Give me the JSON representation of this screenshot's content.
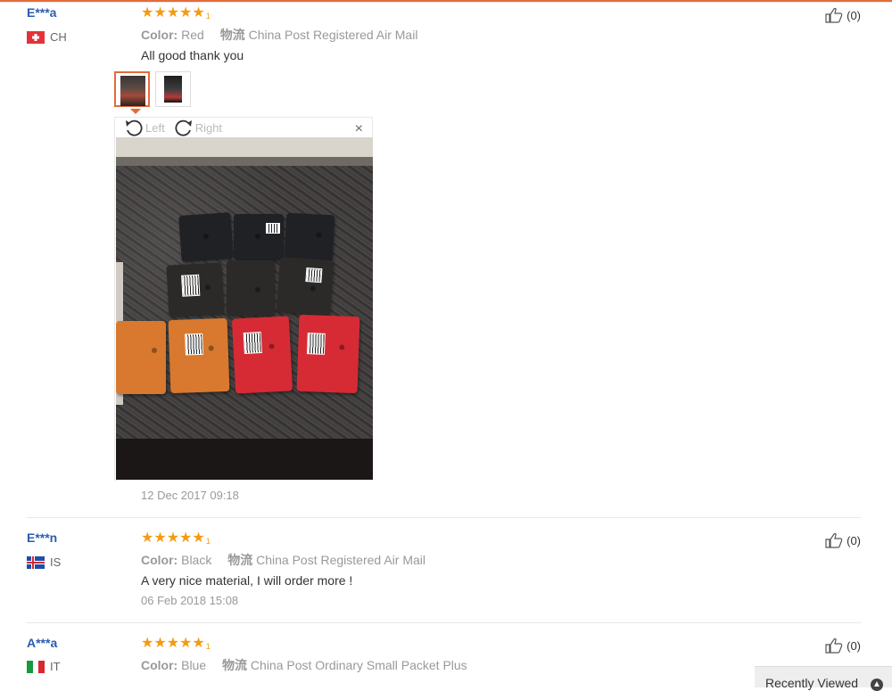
{
  "reviews": [
    {
      "user": "E***a",
      "country": "CH",
      "rating_count": "1",
      "color_label": "Color:",
      "color_value": "Red",
      "ship_label": "物流",
      "ship_value": "China Post Registered Air Mail",
      "text": "All good thank you",
      "date": "12 Dec 2017 09:18",
      "likes": "(0)"
    },
    {
      "user": "E***n",
      "country": "IS",
      "rating_count": "1",
      "color_label": "Color:",
      "color_value": "Black",
      "ship_label": "物流",
      "ship_value": "China Post Registered Air Mail",
      "text": "A very nice material, I will order more !",
      "date": "06 Feb 2018 15:08",
      "likes": "(0)"
    },
    {
      "user": "A***a",
      "country": "IT",
      "rating_count": "1",
      "color_label": "Color:",
      "color_value": "Blue",
      "ship_label": "物流",
      "ship_value": "China Post Ordinary Small Packet Plus",
      "likes": "(0)"
    }
  ],
  "viewer": {
    "rotate_left": "Left",
    "rotate_right": "Right",
    "close": "×"
  },
  "recently_viewed": "Recently Viewed",
  "colors": {
    "accent": "#e46b3a",
    "star": "#f39c12",
    "username": "#2a5db0"
  }
}
